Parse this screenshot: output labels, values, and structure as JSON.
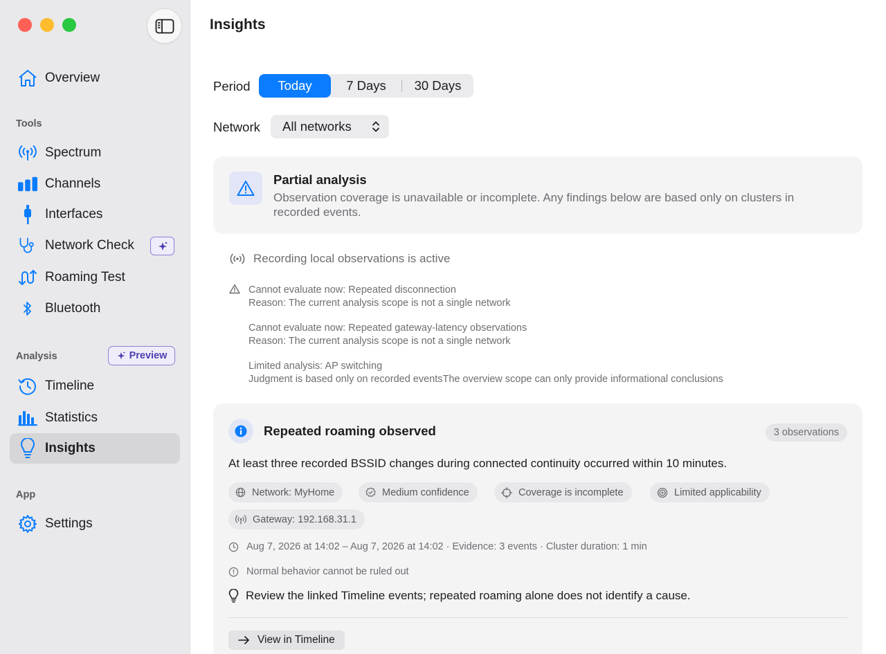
{
  "sidebar": {
    "overview": "Overview",
    "tools_label": "Tools",
    "tools": [
      "Spectrum",
      "Channels",
      "Interfaces",
      "Network Check",
      "Roaming Test",
      "Bluetooth"
    ],
    "analysis_label": "Analysis",
    "preview_badge": "Preview",
    "analysis": [
      "Timeline",
      "Statistics",
      "Insights"
    ],
    "app_label": "App",
    "settings": "Settings",
    "active_item": "Insights",
    "accent_color": "#0a7cff"
  },
  "main": {
    "title": "Insights",
    "period_label": "Period",
    "periods": [
      "Today",
      "7 Days",
      "30 Days"
    ],
    "selected_period": "Today",
    "network_label": "Network",
    "network_value": "All networks",
    "partial": {
      "title": "Partial analysis",
      "text_line1": "Observation coverage is unavailable or incomplete. Any findings below are based only on clusters in",
      "text_line2": "recorded events."
    },
    "recording_status": "Recording local observations is active",
    "limitations": [
      {
        "title": "Cannot evaluate now: Repeated disconnection",
        "reason": "Reason: The current analysis scope is not a single network"
      },
      {
        "title": "Cannot evaluate now: Repeated gateway-latency observations",
        "reason": "Reason: The current analysis scope is not a single network"
      },
      {
        "title": "Limited analysis: AP switching",
        "reason": "Judgment is based only on recorded eventsThe overview scope can only provide informational conclusions"
      }
    ],
    "finding": {
      "title": "Repeated roaming observed",
      "count_badge": "3 observations",
      "summary": "At least three recorded BSSID changes during connected continuity occurred within 10 minutes.",
      "chips": [
        "Network: MyHome",
        "Medium confidence",
        "Coverage is incomplete",
        "Limited applicability",
        "Gateway: 192.168.31.1"
      ],
      "time_range": "Aug 7, 2026 at 14:02 – Aug 7, 2026 at 14:02 · Evidence: 3 events · Cluster duration: 1 min",
      "caveat": "Normal behavior cannot be ruled out",
      "advice": "Review the linked Timeline events; repeated roaming alone does not identify a cause.",
      "action": "View in Timeline"
    }
  }
}
